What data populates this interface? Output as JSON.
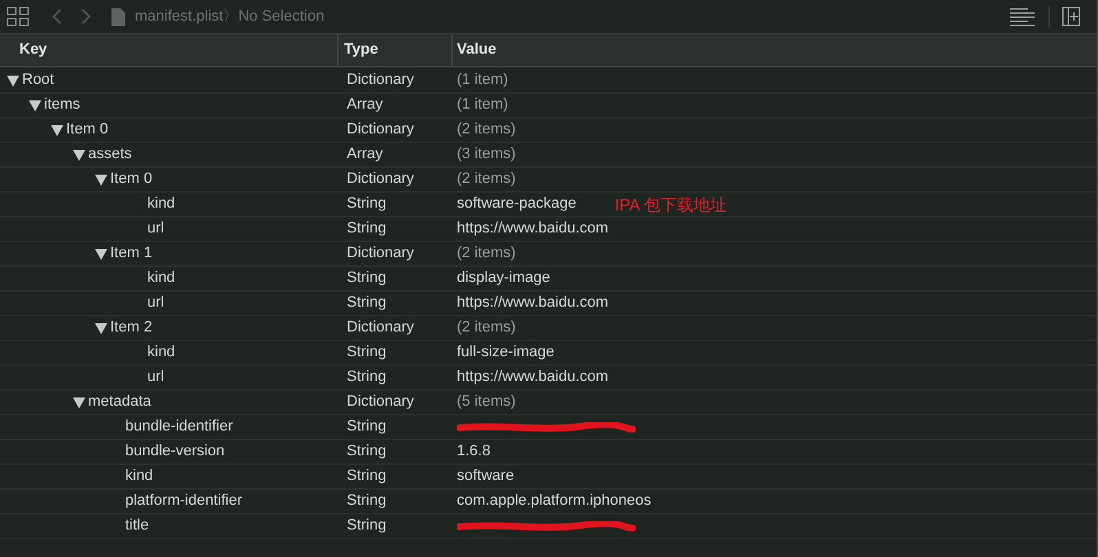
{
  "toolbar": {
    "file_name": "manifest.plist",
    "separator": "〉",
    "selection": "No Selection"
  },
  "columns": [
    "Key",
    "Type",
    "Value"
  ],
  "rows": [
    {
      "key": "Root",
      "type": "Dictionary",
      "value": "(1 item)",
      "expanded": true,
      "children": [
        {
          "key": "items",
          "type": "Array",
          "value": "(1 item)",
          "expanded": true,
          "children": [
            {
              "key": "Item 0",
              "type": "Dictionary",
              "value": "(2 items)",
              "expanded": true,
              "children": [
                {
                  "key": "assets",
                  "type": "Array",
                  "value": "(3 items)",
                  "expanded": true,
                  "children": [
                    {
                      "key": "Item 0",
                      "type": "Dictionary",
                      "value": "(2 items)",
                      "expanded": true,
                      "children": [
                        {
                          "key": "kind",
                          "type": "String",
                          "value": "software-package",
                          "note": "IPA 包下载地址"
                        },
                        {
                          "key": "url",
                          "type": "String",
                          "value": "https://www.baidu.com"
                        }
                      ]
                    },
                    {
                      "key": "Item 1",
                      "type": "Dictionary",
                      "value": "(2 items)",
                      "expanded": true,
                      "children": [
                        {
                          "key": "kind",
                          "type": "String",
                          "value": "display-image"
                        },
                        {
                          "key": "url",
                          "type": "String",
                          "value": "https://www.baidu.com"
                        }
                      ]
                    },
                    {
                      "key": "Item 2",
                      "type": "Dictionary",
                      "value": "(2 items)",
                      "expanded": true,
                      "children": [
                        {
                          "key": "kind",
                          "type": "String",
                          "value": "full-size-image"
                        },
                        {
                          "key": "url",
                          "type": "String",
                          "value": "https://www.baidu.com"
                        }
                      ]
                    }
                  ]
                },
                {
                  "key": "metadata",
                  "type": "Dictionary",
                  "value": "(5 items)",
                  "expanded": true,
                  "children": [
                    {
                      "key": "bundle-identifier",
                      "type": "String",
                      "redacted": true
                    },
                    {
                      "key": "bundle-version",
                      "type": "String",
                      "value": "1.6.8"
                    },
                    {
                      "key": "kind",
                      "type": "String",
                      "value": "software"
                    },
                    {
                      "key": "platform-identifier",
                      "type": "String",
                      "value": "com.apple.platform.iphoneos"
                    },
                    {
                      "key": "title",
                      "type": "String",
                      "redacted": true
                    }
                  ]
                }
              ]
            }
          ]
        }
      ]
    }
  ]
}
